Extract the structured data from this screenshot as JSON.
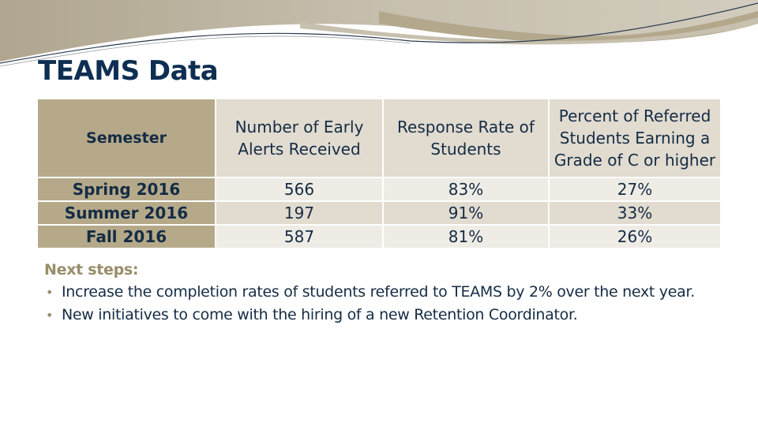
{
  "slide": {
    "title": "TEAMS Data"
  },
  "theme": {
    "accent": "#b5a98a",
    "title_color": "#0e2f52",
    "text_color": "#142c44",
    "header_cell_bg": "#e1dbd0",
    "row_light_bg": "#efece6",
    "row_dark_bg": "#e1dbd0"
  },
  "table": {
    "headers": [
      "Semester",
      "Number of Early Alerts Received",
      "Response Rate of Students",
      "Percent of Referred Students Earning a Grade of C or higher"
    ],
    "rows": [
      {
        "semester": "Spring 2016",
        "early_alerts": "566",
        "response_rate": "83%",
        "percent_c_or_higher": "27%"
      },
      {
        "semester": "Summer 2016",
        "early_alerts": "197",
        "response_rate": "91%",
        "percent_c_or_higher": "33%"
      },
      {
        "semester": "Fall 2016",
        "early_alerts": "587",
        "response_rate": "81%",
        "percent_c_or_higher": "26%"
      }
    ]
  },
  "next_steps": {
    "heading": "Next steps:",
    "bullet_glyph": "•",
    "items": [
      "Increase the completion rates of students referred to TEAMS by 2% over the next year.",
      "New initiatives to come with the hiring of a new Retention Coordinator."
    ]
  }
}
